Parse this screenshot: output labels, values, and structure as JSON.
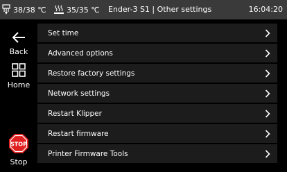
{
  "status_bar": {
    "extruder_temp": "38/38 ℃",
    "bed_temp": "35/35 ℃",
    "title": "Ender-3 S1 | Other settings",
    "time": "16:04:20"
  },
  "sidebar": {
    "back_label": "Back",
    "home_label": "Home",
    "stop_icon_text": "STOP",
    "stop_label": "Stop"
  },
  "menu": {
    "items": [
      {
        "label": "Set time"
      },
      {
        "label": "Advanced options"
      },
      {
        "label": "Restore factory settings"
      },
      {
        "label": "Network settings"
      },
      {
        "label": "Restart Klipper"
      },
      {
        "label": "Restart firmware"
      },
      {
        "label": "Printer Firmware Tools"
      }
    ]
  },
  "colors": {
    "status_bar_bg": "#3a3a3a",
    "menu_item_bg": "#1c1c1c",
    "stop_red": "#e02020"
  }
}
